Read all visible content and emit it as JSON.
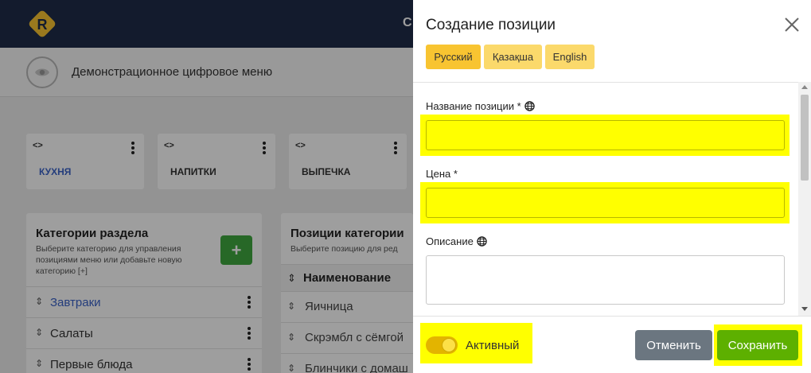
{
  "topbar": {
    "clipped_title": "С"
  },
  "subheader": {
    "title": "Демонстрационное цифровое меню"
  },
  "sections": [
    {
      "code": "<>",
      "name": "КУХНЯ"
    },
    {
      "code": "<>",
      "name": "НАПИТКИ"
    },
    {
      "code": "<>",
      "name": "ВЫПЕЧКА"
    }
  ],
  "categories_panel": {
    "title": "Категории раздела",
    "description": "Выберите категорию для управления позициями меню или добавьте новую категорию [+]",
    "add_label": "+",
    "items": [
      "Завтраки",
      "Салаты",
      "Первые блюда"
    ]
  },
  "items_panel": {
    "title": "Позиции категории",
    "description": "Выберите позицию для ред",
    "header": "Наименование",
    "items": [
      "Яичница",
      "Скрэмбл с сёмгой",
      "Блинчики с домаш"
    ]
  },
  "drawer": {
    "title": "Создание позиции",
    "languages": [
      "Русский",
      "Қазақша",
      "English"
    ],
    "fields": {
      "name_label": "Название позиции *",
      "name_value": "",
      "price_label": "Цена *",
      "price_value": "",
      "description_label": "Описание",
      "description_value": ""
    },
    "toggle_label": "Активный",
    "cancel_label": "Отменить",
    "save_label": "Сохранить"
  },
  "colors": {
    "topbar": "#1f2d4a",
    "accent_yellow": "#f8c431",
    "highlight": "#ffff00",
    "save_green": "#5db000",
    "cancel_gray": "#6b7680",
    "link_blue": "#3b63c9"
  }
}
